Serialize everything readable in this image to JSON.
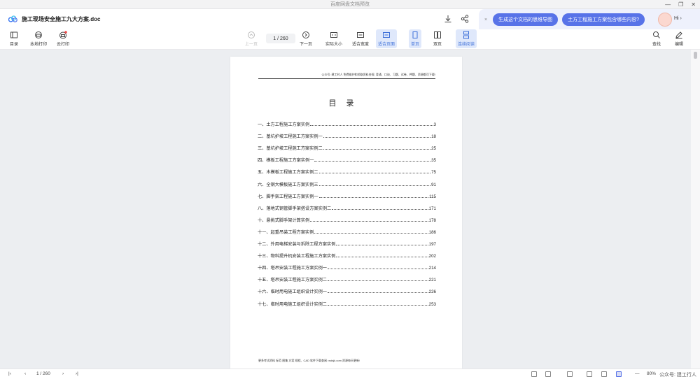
{
  "window": {
    "title": "百度网盘文档预览"
  },
  "header": {
    "doc_title": "施工现场安全施工九大方案.doc"
  },
  "ai_panel": {
    "close": "×",
    "chip1": "生成这个文档的思维导图",
    "chip2": "土方工程施工方案包含哪些内容?",
    "greeting": "Hi ›"
  },
  "toolbar": {
    "toc": "目录",
    "local_print": "本地打印",
    "cloud_print": "云打印",
    "prev": "上一页",
    "page_indicator": "1 / 260",
    "next": "下一页",
    "actual_size": "实际大小",
    "fit_width": "适合宽度",
    "fit_page": "适合页面",
    "single": "单页",
    "double": "双页",
    "continuous": "连续阅读",
    "find": "查找",
    "edit": "编辑"
  },
  "page": {
    "header_text": "公众号: 建工时人  免费维护和领取资料合规, 背诵、口诀、习题、试卷、押题、资源都可下载!",
    "toc_title": "目录",
    "toc": [
      {
        "label": "一、土方工程施工方案实例",
        "page": "3"
      },
      {
        "label": "二、基坑护坡工程施工方案实例一",
        "page": "18"
      },
      {
        "label": "三、基坑护坡工程施工方案实例二",
        "page": "25"
      },
      {
        "label": "四、模板工程施工方案实例一",
        "page": "35"
      },
      {
        "label": "五、木模板工程施工方案实例二",
        "page": "75"
      },
      {
        "label": "六、全钢大模板施工方案实例三",
        "page": "91"
      },
      {
        "label": "七、脚手架工程施工方案实例一",
        "page": "115"
      },
      {
        "label": "八、落地式钢管脚手架搭设方案实例二",
        "page": "171"
      },
      {
        "label": "十、悬挑式脚手架计算实例",
        "page": "178"
      },
      {
        "label": "十一、起重吊装工程方案实例",
        "page": "186"
      },
      {
        "label": "十二、外用电梯安装与拆除工程方案实例",
        "page": "197"
      },
      {
        "label": "十三、物料提升机安装工程施工方案实例",
        "page": "202"
      },
      {
        "label": "十四、塔吊安装工程施工方案实例一",
        "page": "214"
      },
      {
        "label": "十五、塔吊安装工程施工方案实例二",
        "page": "221"
      },
      {
        "label": "十六、临时用电施工组织设计实例一",
        "page": "226"
      },
      {
        "label": "十七、临时用电施工组织设计实例二",
        "page": "253"
      }
    ],
    "footer_text": "更多考试资料  标范  图集  方案  规程、CAD 软件下载查阅: wdsjk.com  资源每天更新!"
  },
  "statusbar": {
    "page_indicator": "1 / 260",
    "zoom": "80%",
    "watermark": "公众号: 建工行人"
  },
  "colors": {
    "accent": "#5873e8",
    "active_bg": "#dfe8fb",
    "doc_bg": "#eceef1"
  }
}
